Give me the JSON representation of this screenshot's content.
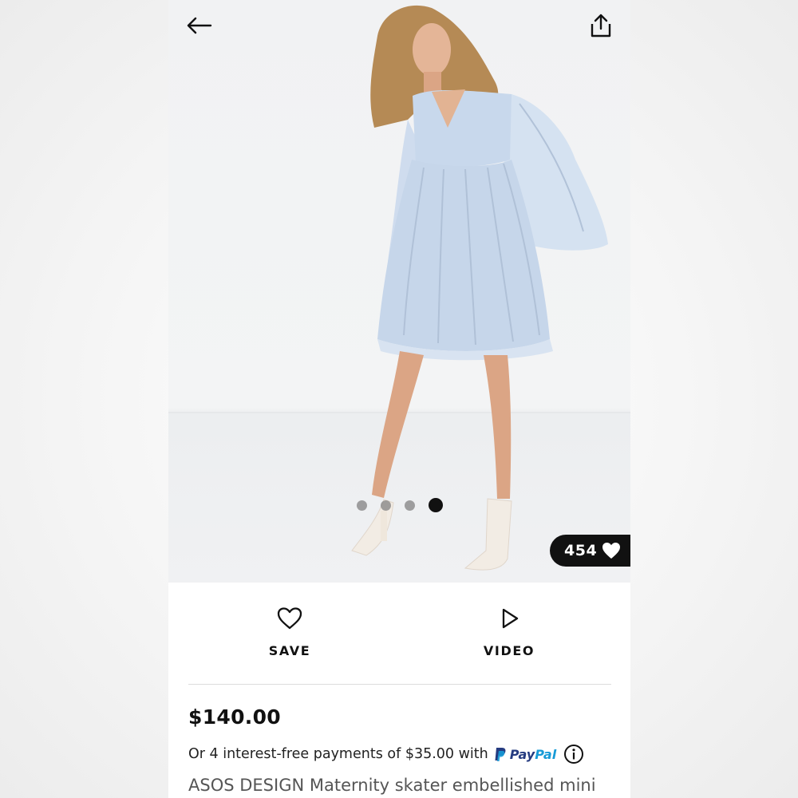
{
  "product": {
    "likes": "454",
    "price": "$140.00",
    "installments_text": "Or 4 interest-free payments of $35.00 with",
    "payment_provider_part1": "Pay",
    "payment_provider_part2": "Pal",
    "title": "ASOS DESIGN Maternity skater embellished mini"
  },
  "gallery": {
    "image_count": 4,
    "active_index": 4
  },
  "actions": {
    "save_label": "SAVE",
    "video_label": "VIDEO"
  },
  "icons": {
    "back": "back-arrow-icon",
    "share": "share-icon",
    "likes": "heart-icon",
    "save": "heart-outline-icon",
    "video": "play-icon",
    "paypal": "paypal-logo-icon",
    "info": "info-icon"
  },
  "colors": {
    "pill_bg": "#111111",
    "paypal_dark": "#253b80",
    "paypal_light": "#179bd7",
    "dress": "#c8d8ec"
  }
}
